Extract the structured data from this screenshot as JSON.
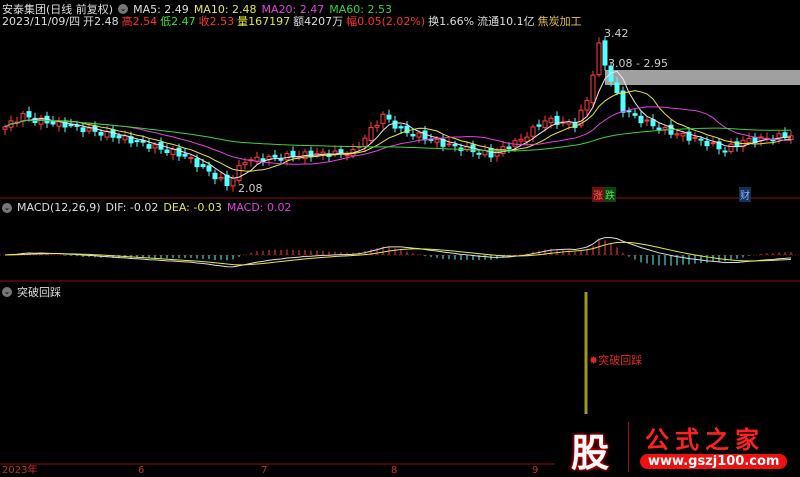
{
  "header": {
    "title": "安泰集团(日线 前复权)",
    "ma5": "MA5: 2.49",
    "ma10": "MA10: 2.48",
    "ma20": "MA20: 2.47",
    "ma60": "MA60: 2.53",
    "date": "2023/11/09/四",
    "open": "开2.48",
    "high": "高2.54",
    "low": "低2.47",
    "close": "收2.53",
    "volume": "量167197",
    "amount": "额4207万",
    "change": "幅0.05(2.02%)",
    "turnover": "换1.66%",
    "float_cap": "流通10.1亿",
    "sector": "焦炭加工"
  },
  "main_panel": {
    "high_label": "3.42",
    "low_label": "2.08",
    "range_label": "3.08 - 2.95",
    "markers": [
      "涨",
      "跌",
      "财"
    ]
  },
  "macd": {
    "name": "MACD(12,26,9)",
    "dif": "DIF: -0.02",
    "dea": "DEA: -0.03",
    "macd": "MACD: 0.02"
  },
  "indicator": {
    "name": "突破回踩",
    "signal_label": "突破回踩"
  },
  "time_axis": [
    "2023年",
    "6",
    "7",
    "8",
    "9"
  ],
  "watermark": {
    "logo_char": "股",
    "name": "公式之家",
    "url": "www.gszj100.com"
  },
  "colors": {
    "up": "#ff3c3c",
    "down": "#54ffff",
    "ma5": "#e8e8e8",
    "ma10": "#e6e63c",
    "ma20": "#e040e0",
    "ma60": "#3cd23c",
    "signal": "#9a9a20"
  },
  "chart_data": {
    "type": "candlestick",
    "price_range": [
      2.08,
      3.42
    ],
    "close_keyframes": [
      [
        0,
        2.6
      ],
      [
        3,
        2.7
      ],
      [
        5,
        2.66
      ],
      [
        10,
        2.62
      ],
      [
        20,
        2.5
      ],
      [
        30,
        2.35
      ],
      [
        36,
        2.14
      ],
      [
        37,
        2.1
      ],
      [
        40,
        2.31
      ],
      [
        50,
        2.36
      ],
      [
        58,
        2.38
      ],
      [
        63,
        2.7
      ],
      [
        66,
        2.57
      ],
      [
        74,
        2.44
      ],
      [
        81,
        2.36
      ],
      [
        86,
        2.49
      ],
      [
        90,
        2.66
      ],
      [
        95,
        2.62
      ],
      [
        97,
        2.83
      ],
      [
        99,
        3.3
      ],
      [
        101,
        3.0
      ],
      [
        103,
        2.75
      ],
      [
        106,
        2.66
      ],
      [
        110,
        2.57
      ],
      [
        116,
        2.48
      ],
      [
        120,
        2.4
      ],
      [
        123,
        2.48
      ],
      [
        127,
        2.5
      ],
      [
        131,
        2.53
      ]
    ]
  }
}
